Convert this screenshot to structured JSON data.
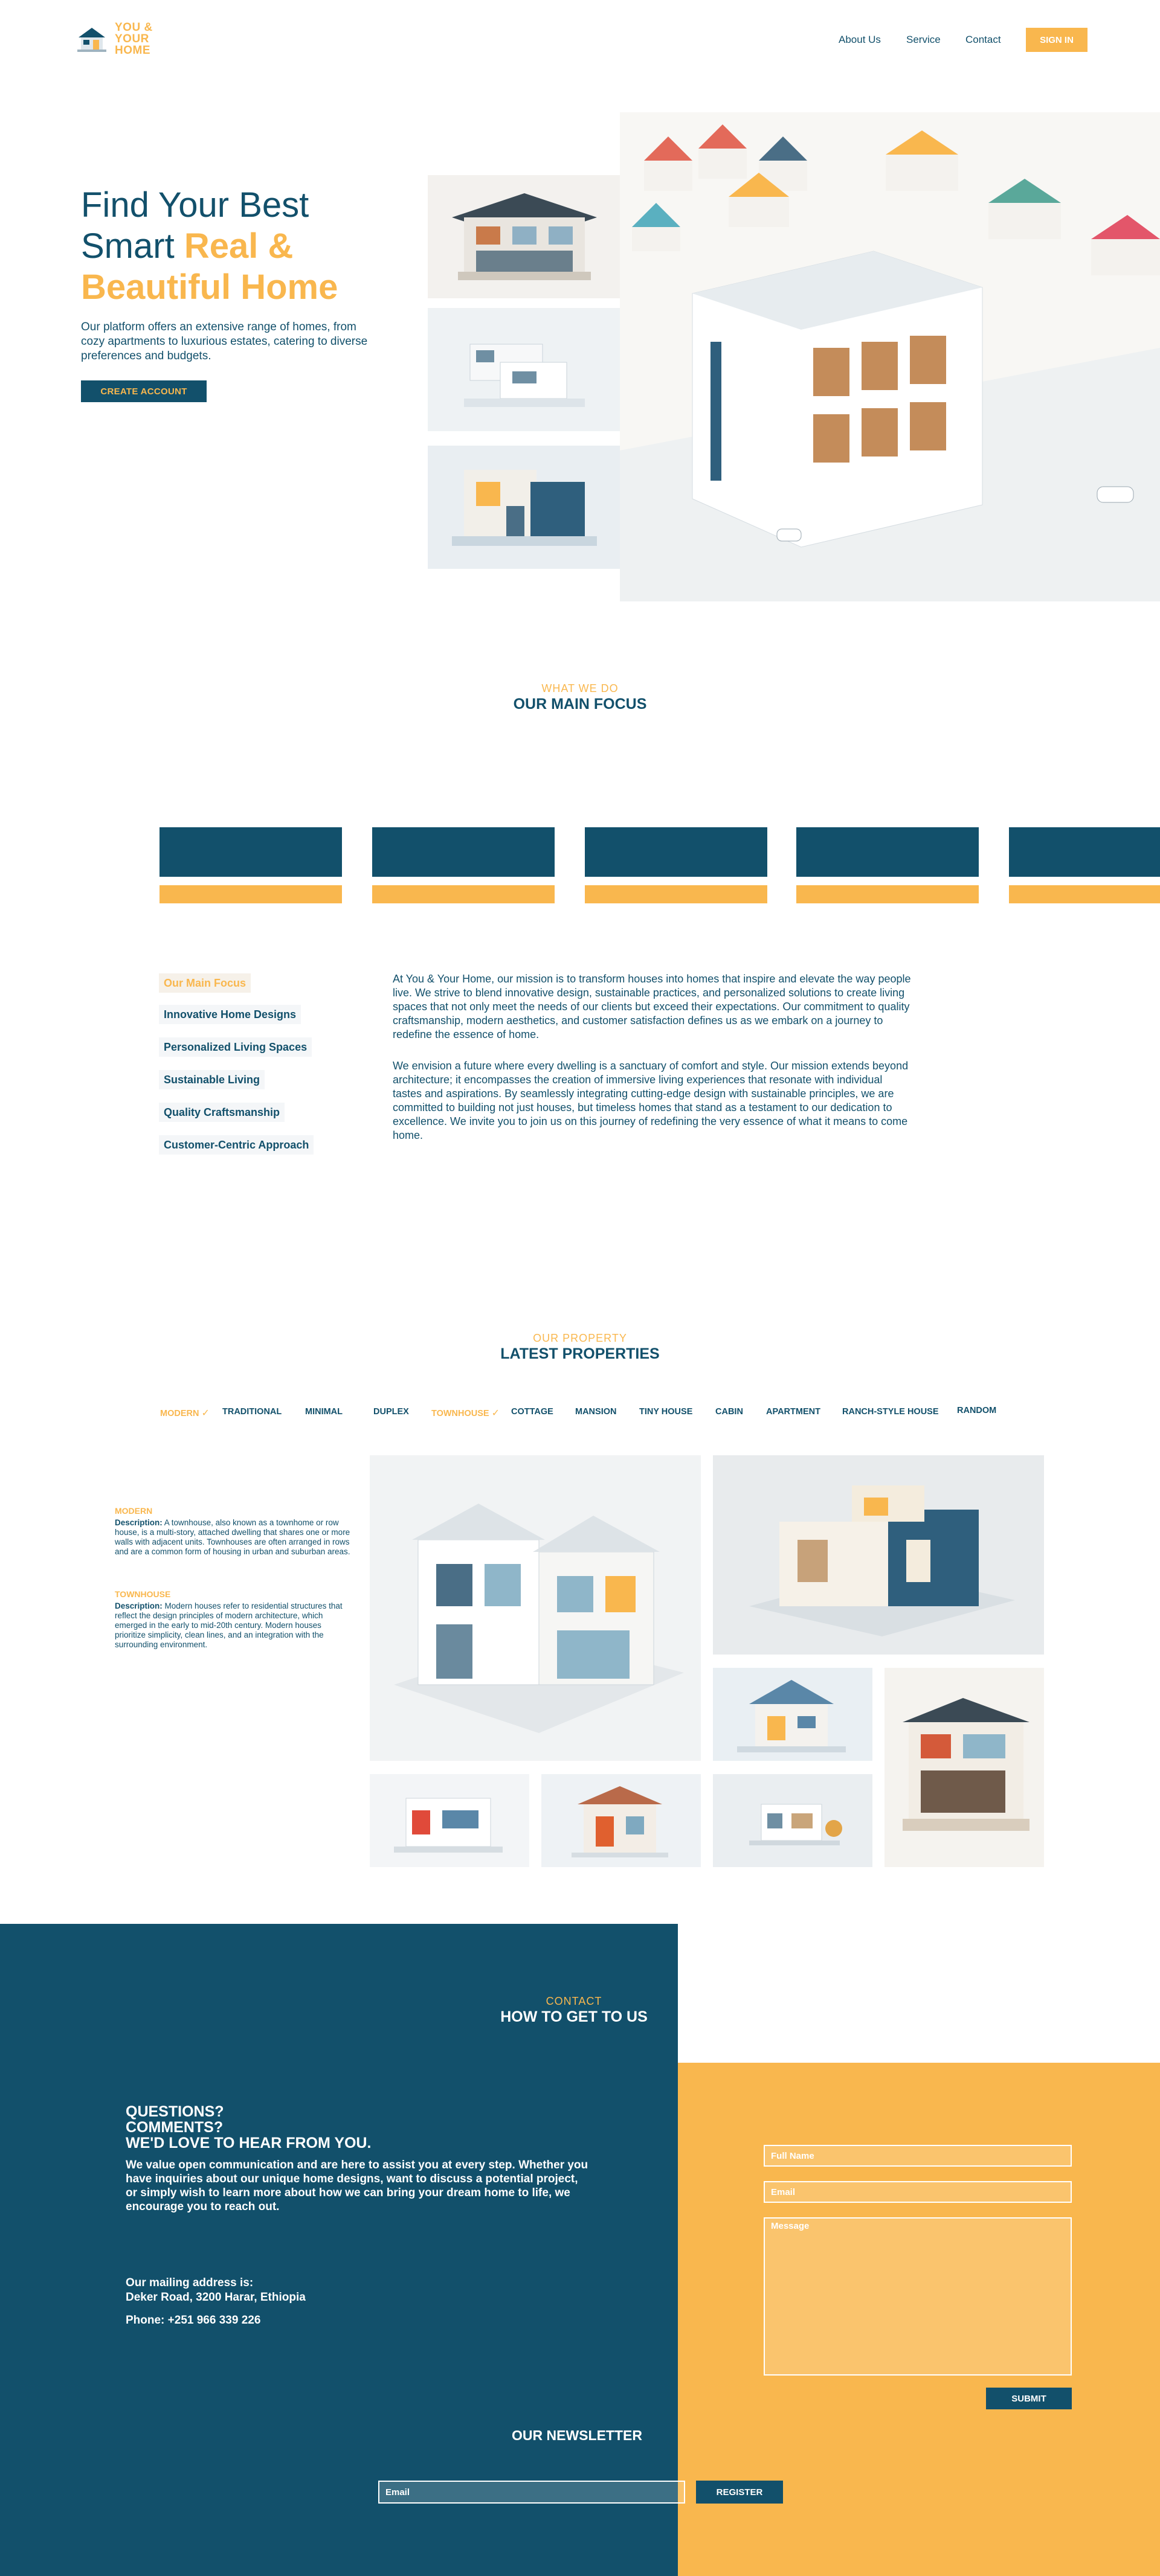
{
  "brand": {
    "line1": "YOU &",
    "line2": "YOUR",
    "line3": "HOME"
  },
  "nav": {
    "about": "About Us",
    "service": "Service",
    "contact": "Contact",
    "signin": "SIGN IN"
  },
  "hero": {
    "title_line1": "Find Your Best",
    "title_line2_plain": "Smart ",
    "title_line2_hl": "Real &",
    "title_line3_hl": "Beautiful Home",
    "description": "Our platform offers an extensive range of homes, from cozy apartments to luxurious estates, catering to diverse preferences and budgets.",
    "cta": "CREATE ACCOUNT"
  },
  "focus_section": {
    "kicker": "WHAT WE DO",
    "title": "OUR MAIN FOCUS",
    "items": [
      "Our Main Focus",
      "Innovative Home Designs",
      "Personalized Living Spaces",
      "Sustainable Living",
      "Quality Craftsmanship",
      "Customer-Centric Approach"
    ],
    "paragraph1": "At You & Your Home, our mission is to transform houses into homes that inspire and elevate the way people live. We strive to blend innovative design, sustainable practices, and personalized solutions to create living spaces that not only meet the needs of our clients but exceed their expectations. Our commitment to quality craftsmanship, modern aesthetics, and customer satisfaction defines us as we embark on a journey to redefine the essence of home.",
    "paragraph2": "We envision a future where every dwelling is a sanctuary of comfort and style. Our mission extends beyond architecture; it encompasses the creation of immersive living experiences that resonate with individual tastes and aspirations. By seamlessly integrating cutting-edge design with sustainable principles, we are committed to building not just houses, but timeless homes that stand as a testament to our dedication to excellence. We invite you to join us on this journey of redefining the very essence of what it means to come home."
  },
  "properties": {
    "kicker": "OUR PROPERTY",
    "title": "LATEST PROPERTIES",
    "filters": [
      "MODERN",
      "TRADITIONAL",
      "MINIMAL",
      "DUPLEX",
      "TOWNHOUSE",
      "COTTAGE",
      "MANSION",
      "TINY HOUSE",
      "CABIN",
      "APARTMENT",
      "RANCH-STYLE HOUSE",
      "RANDOM"
    ],
    "check": "✓",
    "types": [
      {
        "label": "MODERN",
        "desc_label": "Description:",
        "desc": " A townhouse, also known as a townhome or row house, is a multi-story, attached dwelling that shares one or more walls with adjacent units. Townhouses are often arranged in rows and are a common form of housing in urban and suburban areas."
      },
      {
        "label": "TOWNHOUSE",
        "desc_label": "Description:",
        "desc": " Modern houses refer to residential structures that reflect the design principles of modern architecture, which emerged in the early to mid-20th century. Modern houses prioritize simplicity, clean lines, and an integration with the surrounding environment."
      }
    ]
  },
  "contact": {
    "kicker": "CONTACT",
    "title": "HOW TO GET TO US",
    "q_line1": "QUESTIONS?",
    "q_line2": "COMMENTS?",
    "q_line3": "WE'D LOVE TO HEAR FROM YOU.",
    "description": "We value open communication and are here to assist you at every step. Whether you have inquiries about our unique home designs, want to discuss a potential project, or simply wish to learn more about how we can bring your dream home to life, we encourage you to reach out.",
    "address_label": "Our mailing address is:",
    "address": "Deker Road, 3200 Harar, Ethiopia",
    "phone": "Phone: +251 966 339 226",
    "form": {
      "name_placeholder": "Full Name",
      "email_placeholder": "Email",
      "message_placeholder": "Message",
      "submit": "SUBMIT"
    }
  },
  "newsletter": {
    "title": "OUR NEWSLETTER",
    "email_placeholder": "Email",
    "register": "REGISTER"
  },
  "colors": {
    "primary": "#12506b",
    "accent": "#f9b74e",
    "background": "#ffffff"
  },
  "icons": [
    "house-logo-icon",
    "checkmark-icon"
  ]
}
